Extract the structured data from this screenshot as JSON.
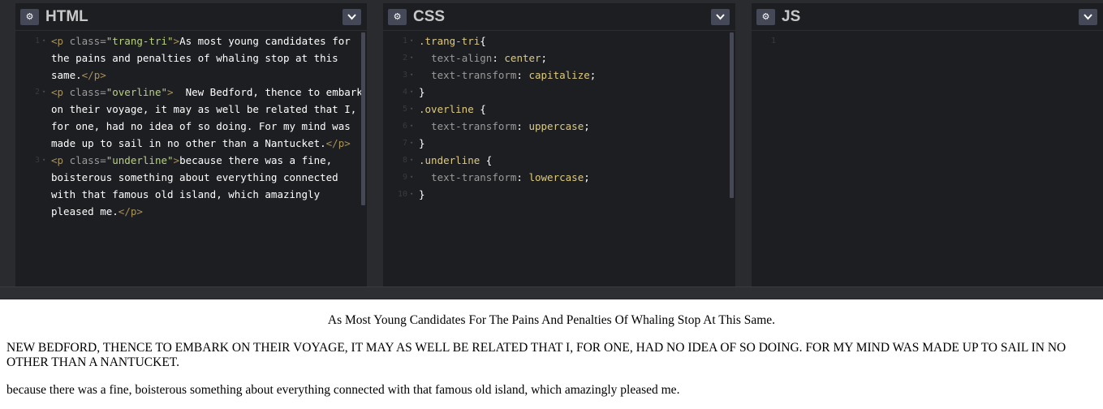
{
  "editors": {
    "html": {
      "title": "HTML",
      "lines": [
        {
          "n": "1",
          "parts": [
            {
              "c": "t-tag",
              "t": "<p "
            },
            {
              "c": "t-attr",
              "t": "class="
            },
            {
              "c": "t-val",
              "t": "\"trang-tri\""
            },
            {
              "c": "t-tag",
              "t": ">"
            },
            {
              "c": "",
              "t": "As most young candidates for the pains and penalties of whaling stop at this same."
            },
            {
              "c": "t-tag",
              "t": "</p>"
            }
          ]
        },
        {
          "n": "2",
          "parts": [
            {
              "c": "t-tag",
              "t": "<p "
            },
            {
              "c": "t-attr",
              "t": "class="
            },
            {
              "c": "t-val",
              "t": "\"overline\""
            },
            {
              "c": "t-tag",
              "t": ">"
            },
            {
              "c": "",
              "t": "  New Bedford, thence to embark on their voyage, it may as well be related that I, for one, had no idea of so doing. For my mind was made up to sail in no other than a Nantucket."
            },
            {
              "c": "t-tag",
              "t": "</p>"
            }
          ]
        },
        {
          "n": "3",
          "parts": [
            {
              "c": "t-tag",
              "t": "<p "
            },
            {
              "c": "t-attr",
              "t": "class="
            },
            {
              "c": "t-val",
              "t": "\"underline\""
            },
            {
              "c": "t-tag",
              "t": ">"
            },
            {
              "c": "",
              "t": "because there was a fine, boisterous something about everything connected with that famous old island, which amazingly pleased me."
            },
            {
              "c": "t-tag",
              "t": "</p>"
            }
          ]
        }
      ]
    },
    "css": {
      "title": "CSS",
      "lines": [
        {
          "n": "1",
          "parts": [
            {
              "c": "t-sel",
              "t": ".trang-tri"
            },
            {
              "c": "t-brace",
              "t": "{"
            }
          ]
        },
        {
          "n": "2",
          "parts": [
            {
              "c": "",
              "t": "  "
            },
            {
              "c": "t-prop",
              "t": "text-align"
            },
            {
              "c": "t-brace",
              "t": ": "
            },
            {
              "c": "t-cval",
              "t": "center"
            },
            {
              "c": "t-brace",
              "t": ";"
            }
          ]
        },
        {
          "n": "3",
          "parts": [
            {
              "c": "",
              "t": "  "
            },
            {
              "c": "t-prop",
              "t": "text-transform"
            },
            {
              "c": "t-brace",
              "t": ": "
            },
            {
              "c": "t-cval",
              "t": "capitalize"
            },
            {
              "c": "t-brace",
              "t": ";"
            }
          ]
        },
        {
          "n": "4",
          "parts": [
            {
              "c": "t-brace",
              "t": "}"
            }
          ]
        },
        {
          "n": "5",
          "parts": [
            {
              "c": "t-sel",
              "t": ".overline "
            },
            {
              "c": "t-brace",
              "t": "{"
            }
          ]
        },
        {
          "n": "6",
          "parts": [
            {
              "c": "",
              "t": "  "
            },
            {
              "c": "t-prop",
              "t": "text-transform"
            },
            {
              "c": "t-brace",
              "t": ": "
            },
            {
              "c": "t-cval",
              "t": "uppercase"
            },
            {
              "c": "t-brace",
              "t": ";"
            }
          ]
        },
        {
          "n": "7",
          "parts": [
            {
              "c": "t-brace",
              "t": "}"
            }
          ]
        },
        {
          "n": "8",
          "parts": [
            {
              "c": "t-sel",
              "t": ".underline "
            },
            {
              "c": "t-brace",
              "t": "{"
            }
          ]
        },
        {
          "n": "9",
          "parts": [
            {
              "c": "",
              "t": "  "
            },
            {
              "c": "t-prop",
              "t": "text-transform"
            },
            {
              "c": "t-brace",
              "t": ": "
            },
            {
              "c": "t-cval",
              "t": "lowercase"
            },
            {
              "c": "t-brace",
              "t": ";"
            }
          ]
        },
        {
          "n": "10",
          "parts": [
            {
              "c": "t-brace",
              "t": "}"
            }
          ]
        }
      ]
    },
    "js": {
      "title": "JS",
      "lines": [
        {
          "n": "1",
          "parts": []
        }
      ]
    }
  },
  "preview": {
    "p1": "As most young candidates for the pains and penalties of whaling stop at this same.",
    "p2": "  New Bedford, thence to embark on their voyage, it may as well be related that I, for one, had no idea of so doing. For my mind was made up to sail in no other than a Nantucket.",
    "p3": "because there was a fine, boisterous something about everything connected with that famous old island, which amazingly pleased me."
  },
  "icons": {
    "settings": "gear-icon",
    "collapse": "chevron-down-icon"
  },
  "colors": {
    "editor_bg": "#1d1e22",
    "frame_bg": "#2a2b2e",
    "button_bg": "#444857",
    "html_tag": "#a7925a",
    "html_attr_value": "#b8d083",
    "css_selector": "#ddca7e"
  }
}
